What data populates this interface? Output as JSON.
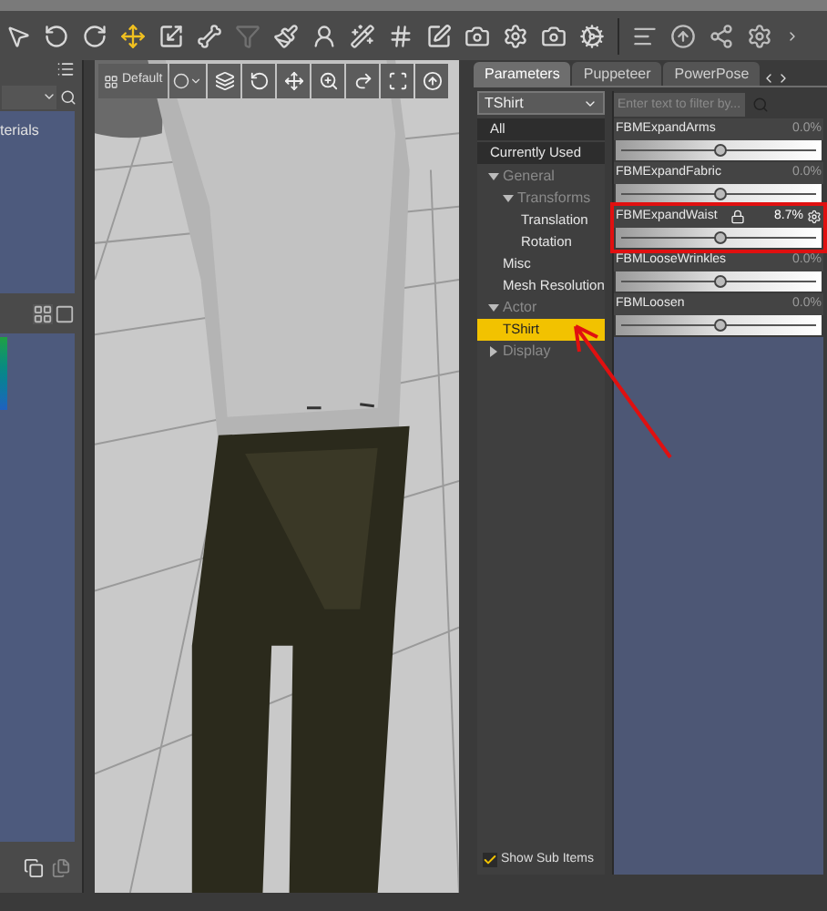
{
  "viewport": {
    "camera": "Default"
  },
  "left_panel": {
    "list_items": [
      "terials"
    ]
  },
  "tabs": [
    {
      "label": "Parameters",
      "selected": true
    },
    {
      "label": "Puppeteer",
      "selected": false
    },
    {
      "label": "PowerPose",
      "selected": false
    }
  ],
  "node_select": {
    "value": "TShirt"
  },
  "filter": {
    "placeholder": "Enter text to filter by..."
  },
  "tree": [
    {
      "label": "All",
      "kind": "item",
      "selected": false
    },
    {
      "label": "Currently Used",
      "kind": "item",
      "selected": false
    },
    {
      "label": "General",
      "kind": "group",
      "expanded": true,
      "children": [
        {
          "label": "Transforms",
          "kind": "group",
          "expanded": true,
          "children": [
            {
              "label": "Translation",
              "kind": "item",
              "selected": false
            },
            {
              "label": "Rotation",
              "kind": "item",
              "selected": false
            }
          ]
        },
        {
          "label": "Misc",
          "kind": "item",
          "selected": false
        },
        {
          "label": "Mesh Resolution",
          "kind": "item",
          "selected": false
        }
      ]
    },
    {
      "label": "Actor",
      "kind": "group",
      "expanded": true,
      "children": [
        {
          "label": "TShirt",
          "kind": "item",
          "selected": true
        }
      ]
    },
    {
      "label": "Display",
      "kind": "group",
      "expanded": false
    }
  ],
  "properties": [
    {
      "name": "FBMExpandArms",
      "value": "0.0%",
      "level": 0.5,
      "active": false,
      "annotated": false
    },
    {
      "name": "FBMExpandFabric",
      "value": "0.0%",
      "level": 0.5,
      "active": false,
      "annotated": false
    },
    {
      "name": "FBMExpandWaist",
      "value": "8.7%",
      "level": 0.5,
      "active": true,
      "annotated": true
    },
    {
      "name": "FBMLooseWrinkles",
      "value": "0.0%",
      "level": 0.5,
      "active": false,
      "annotated": false
    },
    {
      "name": "FBMLoosen",
      "value": "0.0%",
      "level": 0.5,
      "active": false,
      "annotated": false
    }
  ],
  "show_sub_items": {
    "label": "Show Sub Items",
    "checked": true
  }
}
